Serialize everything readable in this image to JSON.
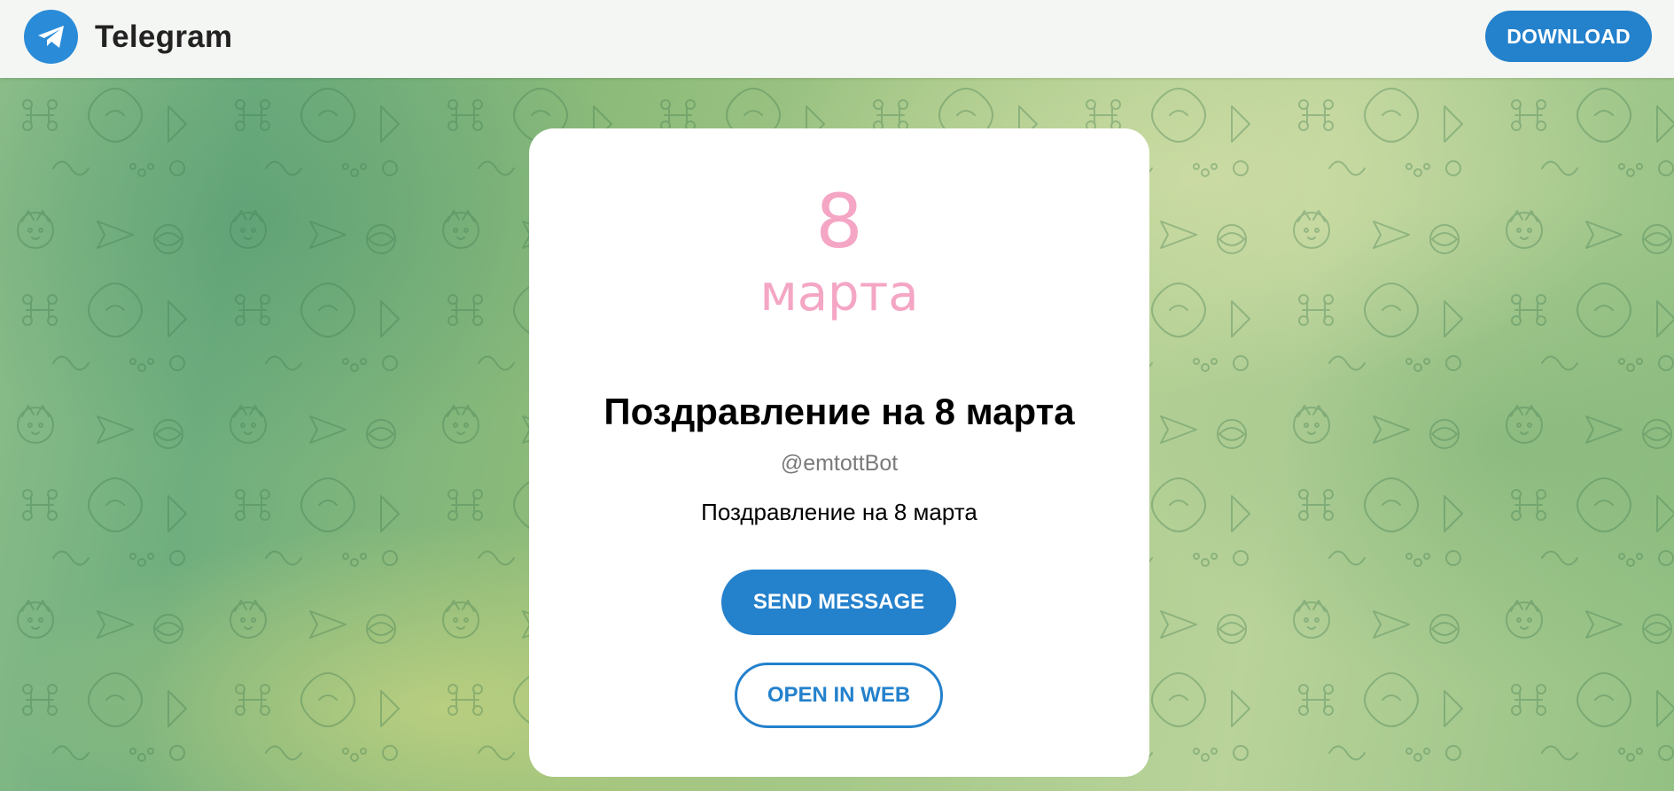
{
  "header": {
    "brand": "Telegram",
    "download_label": "DOWNLOAD"
  },
  "card": {
    "avatar_number": "8",
    "avatar_word": "марта",
    "title": "Поздравление на 8 марта",
    "username": "@emtottBot",
    "description": "Поздравление на 8 марта",
    "send_message_label": "SEND MESSAGE",
    "open_in_web_label": "OPEN IN WEB"
  },
  "colors": {
    "accent": "#2481cc",
    "avatar_pink": "#f4a6c4",
    "card_background": "#ffffff",
    "header_background": "#f4f6f3"
  },
  "icons": {
    "brand_logo": "paper-plane-icon",
    "background": "doodle-pattern"
  }
}
